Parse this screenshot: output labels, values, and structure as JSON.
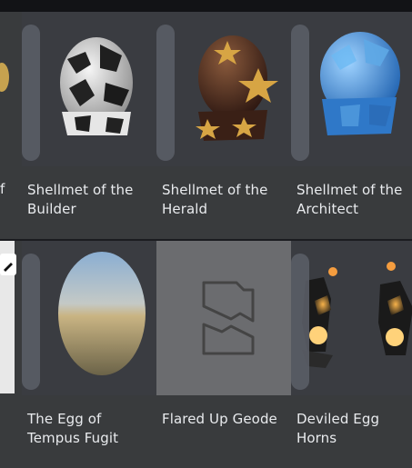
{
  "items": [
    {
      "name": "Shellmet of the Builder"
    },
    {
      "name": "Shellmet of the Herald"
    },
    {
      "name": "Shellmet of the Architect"
    },
    {
      "name": "The Egg of Tempus Fugit"
    },
    {
      "name": "Flared Up Geode"
    },
    {
      "name": "Deviled Egg Horns"
    }
  ],
  "left_partial": {
    "caption_fragment": "f"
  },
  "icons": {
    "placeholder": "broken-image-icon",
    "partial_left": "edit-icon"
  },
  "colors": {
    "background": "#1b1c20",
    "card": "#393b3d",
    "text": "#e9ebee",
    "placeholder": "#6b6c6f"
  }
}
